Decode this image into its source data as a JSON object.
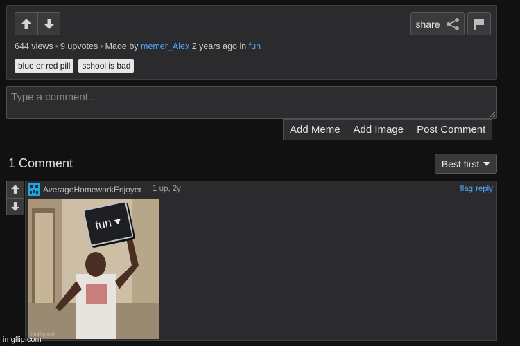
{
  "post": {
    "views": "644 views",
    "upvotes": "9 upvotes",
    "made_by": "Made by",
    "author": "memer_Alex",
    "age": "2 years ago in",
    "stream": "fun",
    "share_label": "share",
    "tags": [
      "blue or red pill",
      "school is bad"
    ]
  },
  "composer": {
    "placeholder": "Type a comment..",
    "add_meme": "Add Meme",
    "add_image": "Add Image",
    "post_comment": "Post Comment"
  },
  "comments": {
    "count_label": "1 Comment",
    "sort_label": "Best first",
    "items": [
      {
        "username": "AverageHomeworkEnjoyer",
        "meta": "1 up, 2y",
        "flag": "flag",
        "reply": "reply",
        "meme_sign": "fun",
        "meme_watermark": "imgflip.com"
      }
    ]
  },
  "watermark": "imgflip.com",
  "colors": {
    "background": "#111112",
    "panel": "#2b2b2d",
    "link": "#4fa7ff",
    "avatar": "#1aa7e6"
  }
}
